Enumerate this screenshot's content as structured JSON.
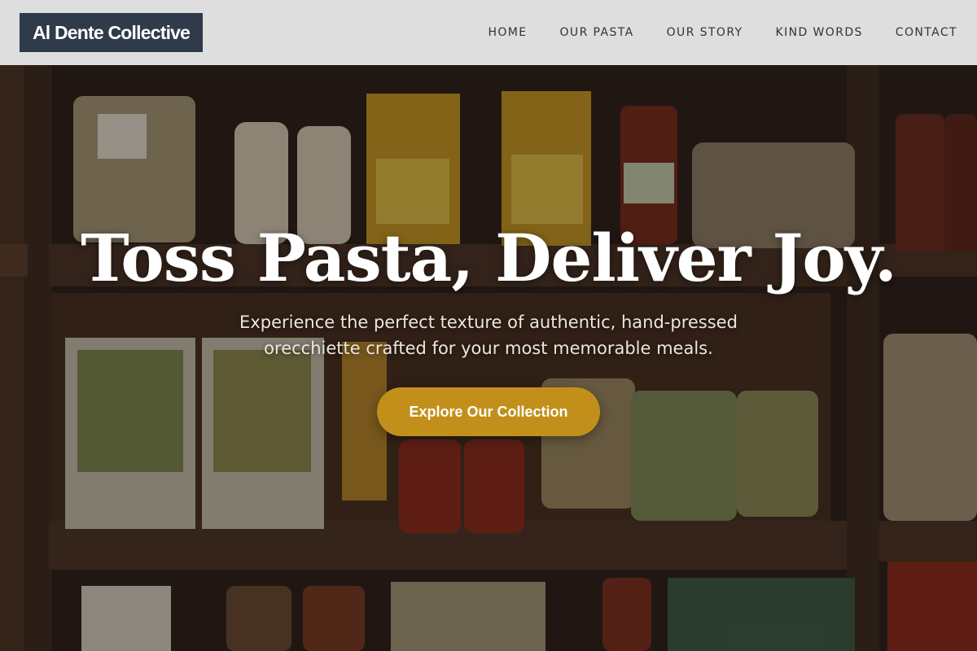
{
  "brand": {
    "name": "Al Dente Collective"
  },
  "nav": {
    "items": [
      "HOME",
      "OUR PASTA",
      "OUR STORY",
      "KIND WORDS",
      "CONTACT"
    ]
  },
  "hero": {
    "title": "Toss Pasta, Deliver Joy.",
    "subtitle": "Experience the perfect texture of authentic, hand-pressed orecchiette crafted for your most memorable meals.",
    "cta_label": "Explore Our Collection",
    "background_image": "pantry-shelves-with-pasta-and-jars"
  },
  "colors": {
    "header_bg": "#eeeeee",
    "logo_bg": "#2f3b4a",
    "nav_text": "#2b3440",
    "cta_bg": "#c2901a",
    "hero_title": "#ffffff"
  }
}
